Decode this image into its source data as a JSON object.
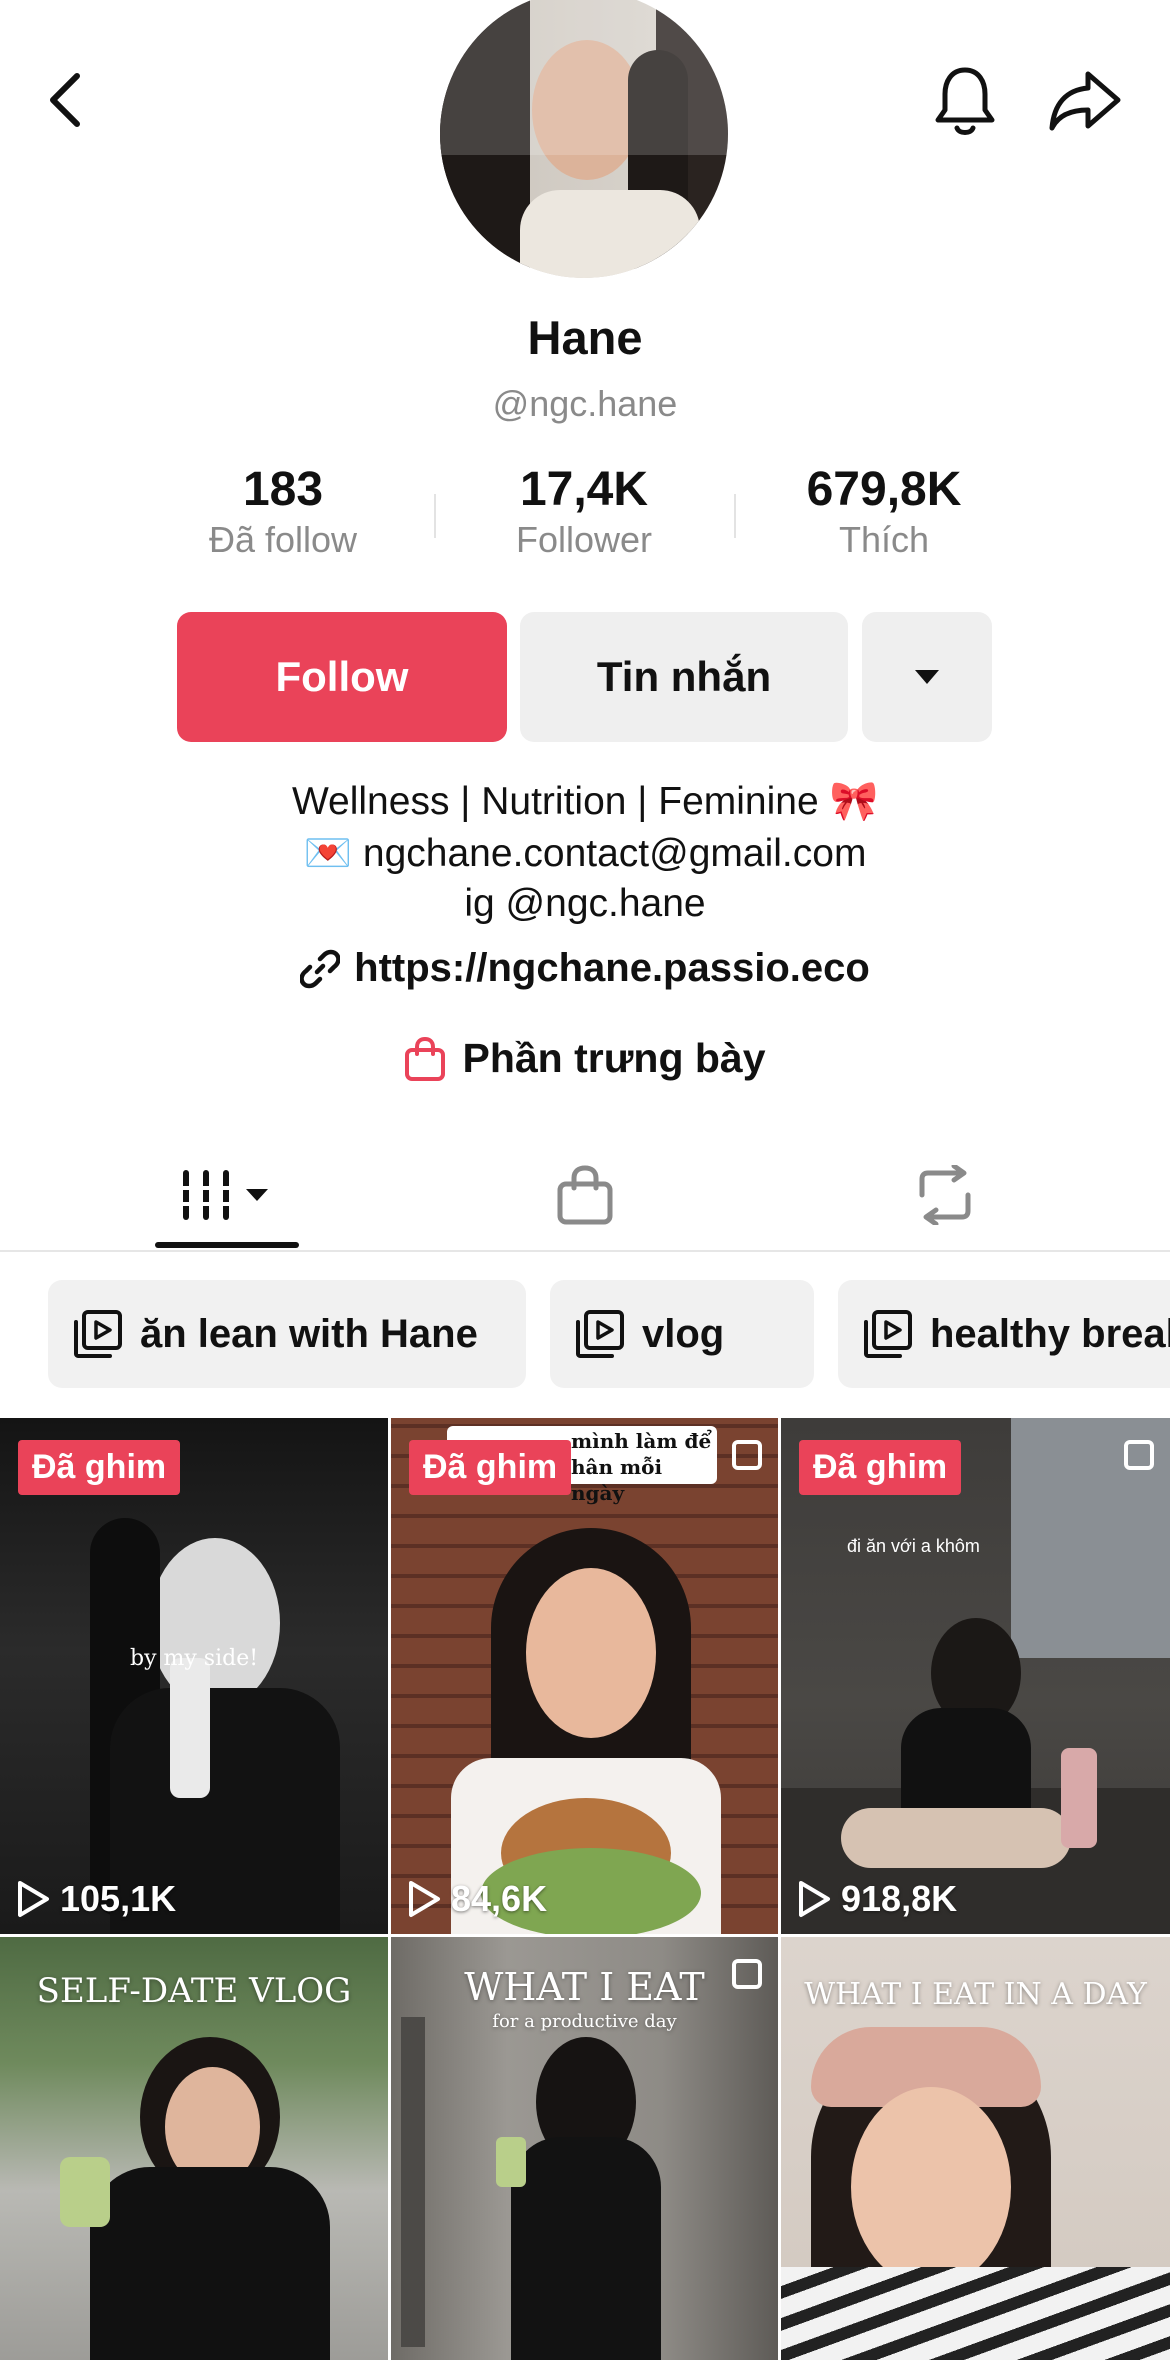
{
  "profile": {
    "name": "Hane",
    "handle": "@ngc.hane"
  },
  "stats": [
    {
      "value": "183",
      "label": "Đã follow"
    },
    {
      "value": "17,4K",
      "label": "Follower"
    },
    {
      "value": "679,8K",
      "label": "Thích"
    }
  ],
  "actions": {
    "follow_label": "Follow",
    "message_label": "Tin nhắn"
  },
  "bio": {
    "line1": "Wellness | Nutrition | Feminine 🎀",
    "line2": "💌 ngchane.contact@gmail.com",
    "line3": "ig @ngc.hane",
    "link": "https://ngchane.passio.eco",
    "showcase": "Phần trưng bày"
  },
  "playlists": [
    {
      "label": "ăn lean with Hane"
    },
    {
      "label": "vlog"
    },
    {
      "label": "healthy breakfast"
    }
  ],
  "videos": [
    {
      "pinned": "Đã ghim",
      "views": "105,1K",
      "caption": "by my side!"
    },
    {
      "pinned": "Đã ghim",
      "views": "84,6K",
      "caption": "mình làm để\nhân mỗi ngày"
    },
    {
      "pinned": "Đã ghim",
      "views": "918,8K",
      "caption": "đi ăn với a khôm"
    },
    {
      "title": "SELF-DATE VLOG"
    },
    {
      "title": "WHAT I EAT",
      "subtitle": "for a productive day"
    },
    {
      "title": "WHAT I EAT IN A DAY"
    }
  ],
  "colors": {
    "accent": "#ea4359",
    "muted_text": "#8a8a8a",
    "chip_bg": "#f1f1f1"
  },
  "icons": {
    "back": "chevron-left-icon",
    "bell": "bell-icon",
    "share": "share-arrow-icon",
    "dropdown": "caret-down-icon",
    "link": "link-icon",
    "shop": "shopping-bag-icon",
    "grid": "grid-icon",
    "repost": "repost-icon",
    "playlist": "playlist-icon",
    "play": "play-icon"
  }
}
